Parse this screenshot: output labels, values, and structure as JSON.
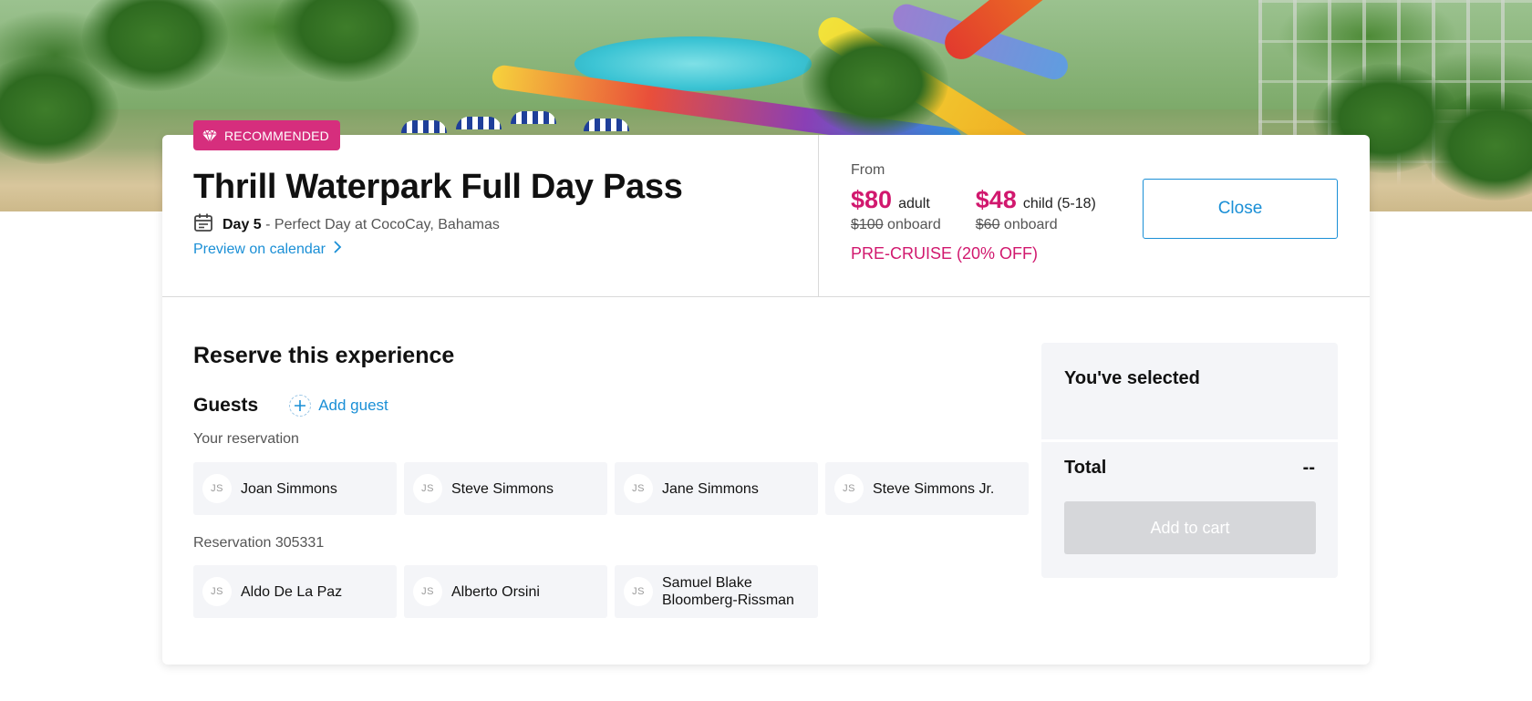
{
  "hero": {
    "image": "waterpark-scene"
  },
  "badge": {
    "label": "RECOMMENDED",
    "icon": "diamond-icon",
    "color": "#d62e7d"
  },
  "experience": {
    "title": "Thrill Waterpark Full Day Pass",
    "day": "Day 5",
    "place": "- Perfect Day at CocoCay, Bahamas",
    "calendar_icon": "calendar-icon",
    "preview_link": "Preview on calendar"
  },
  "pricing": {
    "from_label": "From",
    "adult": {
      "price": "$80",
      "label": "adult",
      "onboard_price": "$100",
      "onboard_label": "onboard"
    },
    "child": {
      "price": "$48",
      "label": "child (5-18)",
      "onboard_price": "$60",
      "onboard_label": "onboard"
    },
    "discount": "PRE-CRUISE (20% OFF)",
    "accent": "#d1186e"
  },
  "close_label": "Close",
  "reserve": {
    "title": "Reserve this experience",
    "guests_label": "Guests",
    "add_guest": "Add guest",
    "groups": [
      {
        "label": "Your reservation",
        "guests": [
          {
            "initials": "JS",
            "name": "Joan Simmons"
          },
          {
            "initials": "JS",
            "name": "Steve Simmons"
          },
          {
            "initials": "JS",
            "name": "Jane Simmons"
          },
          {
            "initials": "JS",
            "name": "Steve Simmons Jr."
          }
        ]
      },
      {
        "label": "Reservation 305331",
        "guests": [
          {
            "initials": "JS",
            "name": "Aldo De La Paz"
          },
          {
            "initials": "JS",
            "name": "Alberto Orsini"
          },
          {
            "initials": "JS",
            "name": "Samuel Blake Bloomberg-Rissman"
          }
        ]
      }
    ]
  },
  "summary": {
    "title": "You've selected",
    "total_label": "Total",
    "total_value": "--",
    "add_to_cart": "Add to cart"
  },
  "colors": {
    "link": "#1a8fd6",
    "panel": "#f4f5f8",
    "disabled": "#d6d7da"
  }
}
